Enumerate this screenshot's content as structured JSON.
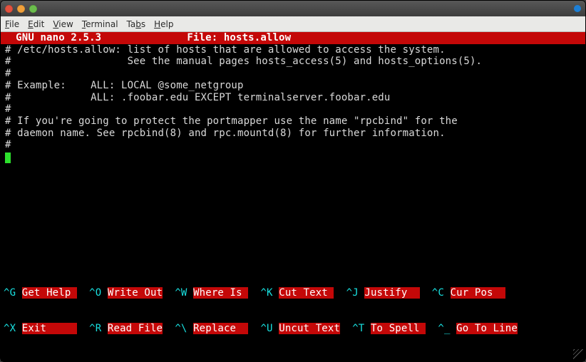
{
  "window": {
    "menus": {
      "file": "File",
      "edit": "Edit",
      "view": "View",
      "terminal": "Terminal",
      "tabs": "Tabs",
      "help": "Help"
    }
  },
  "nano": {
    "app_label": "  GNU nano 2.5.3",
    "file_label": "File: hosts.allow",
    "lines": [
      "# /etc/hosts.allow: list of hosts that are allowed to access the system.",
      "#                   See the manual pages hosts_access(5) and hosts_options(5).",
      "#",
      "# Example:    ALL: LOCAL @some_netgroup",
      "#             ALL: .foobar.edu EXCEPT terminalserver.foobar.edu",
      "#",
      "# If you're going to protect the portmapper use the name \"rpcbind\" for the",
      "# daemon name. See rpcbind(8) and rpc.mountd(8) for further information.",
      "#"
    ],
    "shortcuts_row1": [
      {
        "key": "^G",
        "label": "Get Help "
      },
      {
        "key": "^O",
        "label": "Write Out"
      },
      {
        "key": "^W",
        "label": "Where Is "
      },
      {
        "key": "^K",
        "label": "Cut Text "
      },
      {
        "key": "^J",
        "label": "Justify  "
      },
      {
        "key": "^C",
        "label": "Cur Pos  "
      }
    ],
    "shortcuts_row2": [
      {
        "key": "^X",
        "label": "Exit     "
      },
      {
        "key": "^R",
        "label": "Read File"
      },
      {
        "key": "^\\",
        "label": "Replace  "
      },
      {
        "key": "^U",
        "label": "Uncut Text"
      },
      {
        "key": "^T",
        "label": "To Spell "
      },
      {
        "key": "^_",
        "label": "Go To Line"
      }
    ]
  }
}
